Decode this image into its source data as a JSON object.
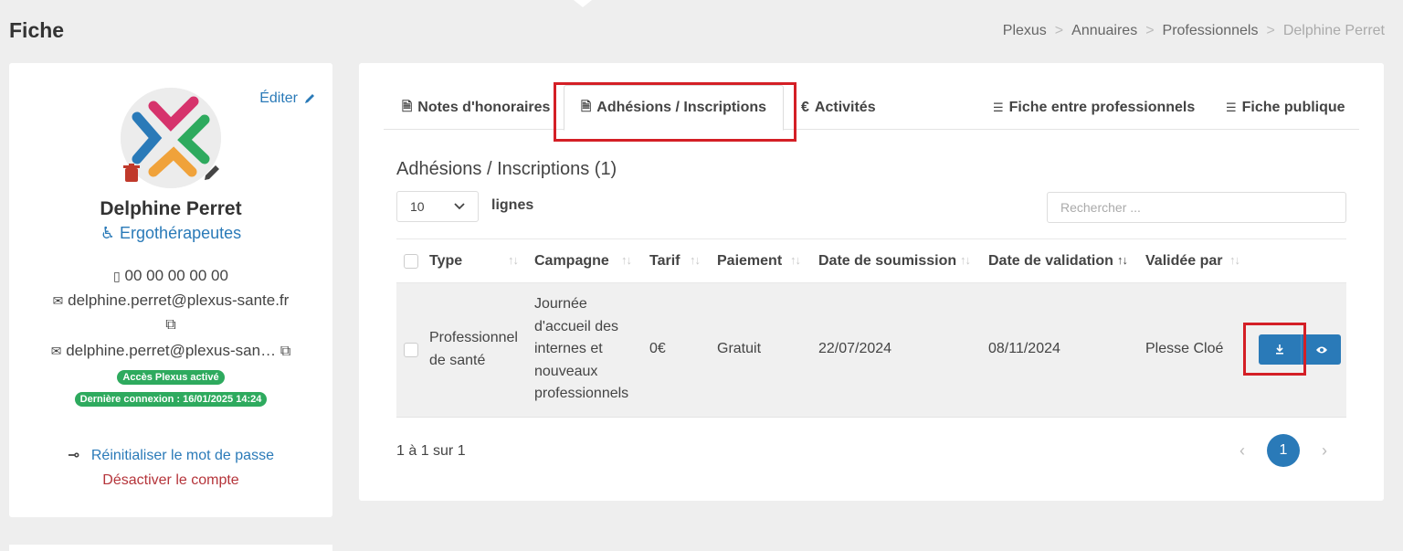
{
  "header": {
    "title": "Fiche",
    "breadcrumb": [
      "Plexus",
      "Annuaires",
      "Professionnels",
      "Delphine Perret"
    ],
    "separator": ">"
  },
  "profile": {
    "edit_label": "Éditer",
    "name": "Delphine Perret",
    "specialty": "Ergothérapeutes",
    "phone": "00 00 00 00 00",
    "email": "delphine.perret@plexus-sante.fr",
    "email_secure": "delphine.perret@plexus-san…",
    "access_badge": "Accès Plexus activé",
    "last_login_badge": "Dernière connexion : 16/01/2025 14:24",
    "reset_password": "Réinitialiser le mot de passe",
    "disable_account": "Désactiver le compte"
  },
  "tabs": [
    {
      "label": "Notes d'honoraires",
      "icon": "document-search-icon"
    },
    {
      "label": "Adhésions / Inscriptions",
      "icon": "document-search-icon",
      "active": true
    },
    {
      "label": "Activités",
      "icon": "euro-icon"
    },
    {
      "label": "Fiche entre professionnels",
      "icon": "contact-card-icon"
    },
    {
      "label": "Fiche publique",
      "icon": "contact-card-icon"
    }
  ],
  "section": {
    "title": "Adhésions / Inscriptions (1)",
    "rows_value": "10",
    "rows_label": "lignes",
    "search_placeholder": "Rechercher ..."
  },
  "table": {
    "columns": [
      "Type",
      "Campagne",
      "Tarif",
      "Paiement",
      "Date de soumission",
      "Date de validation",
      "Validée par"
    ],
    "rows": [
      {
        "type": "Professionnel de santé",
        "campagne": "Journée d'accueil des internes et nouveaux professionnels",
        "tarif": "0€",
        "paiement": "Gratuit",
        "date_soumission": "22/07/2024",
        "date_validation": "08/11/2024",
        "validee_par": "Plesse Cloé"
      }
    ],
    "info": "1 à 1 sur 1",
    "current_page": "1"
  },
  "colors": {
    "accent": "#2a7ab8",
    "highlight": "#d41f26",
    "success": "#2eaa5e",
    "danger": "#b5343a"
  }
}
